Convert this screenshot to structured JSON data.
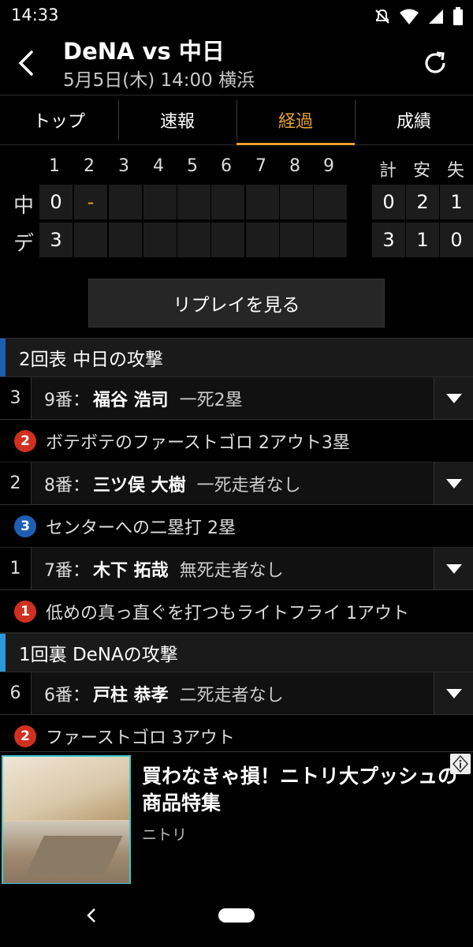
{
  "status": {
    "time": "14:33"
  },
  "header": {
    "title": "DeNA vs 中日",
    "subtitle": "5月5日(木) 14:00 横浜"
  },
  "tabs": [
    {
      "label": "トップ",
      "active": false
    },
    {
      "label": "速報",
      "active": false
    },
    {
      "label": "経過",
      "active": true
    },
    {
      "label": "成績",
      "active": false
    }
  ],
  "scoreboard": {
    "innings": [
      "1",
      "2",
      "3",
      "4",
      "5",
      "6",
      "7",
      "8",
      "9"
    ],
    "totals_headers": [
      "計",
      "安",
      "失"
    ],
    "teams": [
      {
        "name": "中",
        "scores": [
          "0",
          "-",
          "",
          "",
          "",
          "",
          "",
          "",
          ""
        ],
        "totals": [
          "0",
          "2",
          "1"
        ]
      },
      {
        "name": "デ",
        "scores": [
          "3",
          "",
          "",
          "",
          "",
          "",
          "",
          "",
          ""
        ],
        "totals": [
          "3",
          "1",
          "0"
        ]
      }
    ]
  },
  "replay_label": "リプレイを見る",
  "sections": [
    {
      "title": "2回表 中日の攻撃",
      "bar_color": "#1e5fb4",
      "entries": [
        {
          "order": "3",
          "num": "9番：",
          "name": "福谷 浩司",
          "state": "一死2塁",
          "result_badge": "2",
          "badge_color": "#d03020",
          "result": "ボテボテのファーストゴロ 2アウト3塁"
        },
        {
          "order": "2",
          "num": "8番：",
          "name": "三ツ俣 大樹",
          "state": "一死走者なし",
          "result_badge": "3",
          "badge_color": "#1e5fb4",
          "result": "センターへの二塁打 2塁"
        },
        {
          "order": "1",
          "num": "7番：",
          "name": "木下 拓哉",
          "state": "無死走者なし",
          "result_badge": "1",
          "badge_color": "#d03020",
          "result": "低めの真っ直ぐを打つもライトフライ 1アウト"
        }
      ]
    },
    {
      "title": "1回裏 DeNAの攻撃",
      "bar_color": "#2a9ad8",
      "entries": [
        {
          "order": "6",
          "num": "6番：",
          "name": "戸柱 恭孝",
          "state": "二死走者なし",
          "result_badge": "2",
          "badge_color": "#d03020",
          "result": "ファーストゴロ 3アウト"
        }
      ]
    }
  ],
  "ad": {
    "title": "買わなきゃ損！ニトリ大プッシュの商品特集",
    "sponsor": "ニトリ"
  }
}
